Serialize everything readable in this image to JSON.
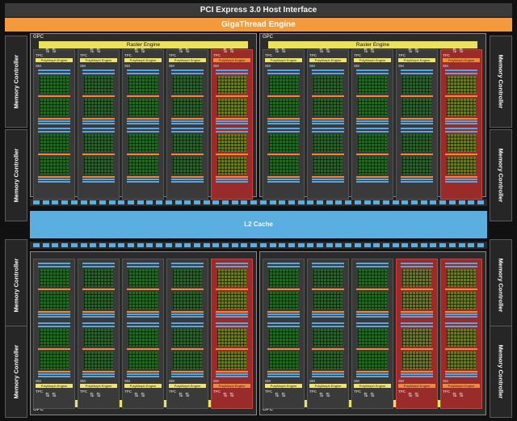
{
  "top_bars": {
    "pcie": "PCI Express 3.0 Host Interface",
    "giga": "GigaThread Engine"
  },
  "memory_controller_label": "Memory Controller",
  "gpc": {
    "label": "GPC",
    "raster_label": "Raster Engine",
    "tpc_label": "TPC",
    "polymorph_label": "PolyMorph Engine",
    "sm_label": "SM"
  },
  "l2_label": "L2 Cache",
  "icons": {
    "arrows": "updown-arrows-icon"
  },
  "colors": {
    "giga": "#f59a3a",
    "raster": "#ece25a",
    "l2": "#5aaee0",
    "disabled_tpc": "#9a2b2b",
    "cores": "#1f6b1f"
  },
  "gpcs": [
    {
      "id": "gpc-top-left",
      "red_tpcs": [
        4
      ]
    },
    {
      "id": "gpc-top-right",
      "red_tpcs": [
        4
      ]
    },
    {
      "id": "gpc-bottom-left",
      "red_tpcs": [
        4
      ]
    },
    {
      "id": "gpc-bottom-right",
      "red_tpcs": [
        3,
        4
      ]
    }
  ]
}
